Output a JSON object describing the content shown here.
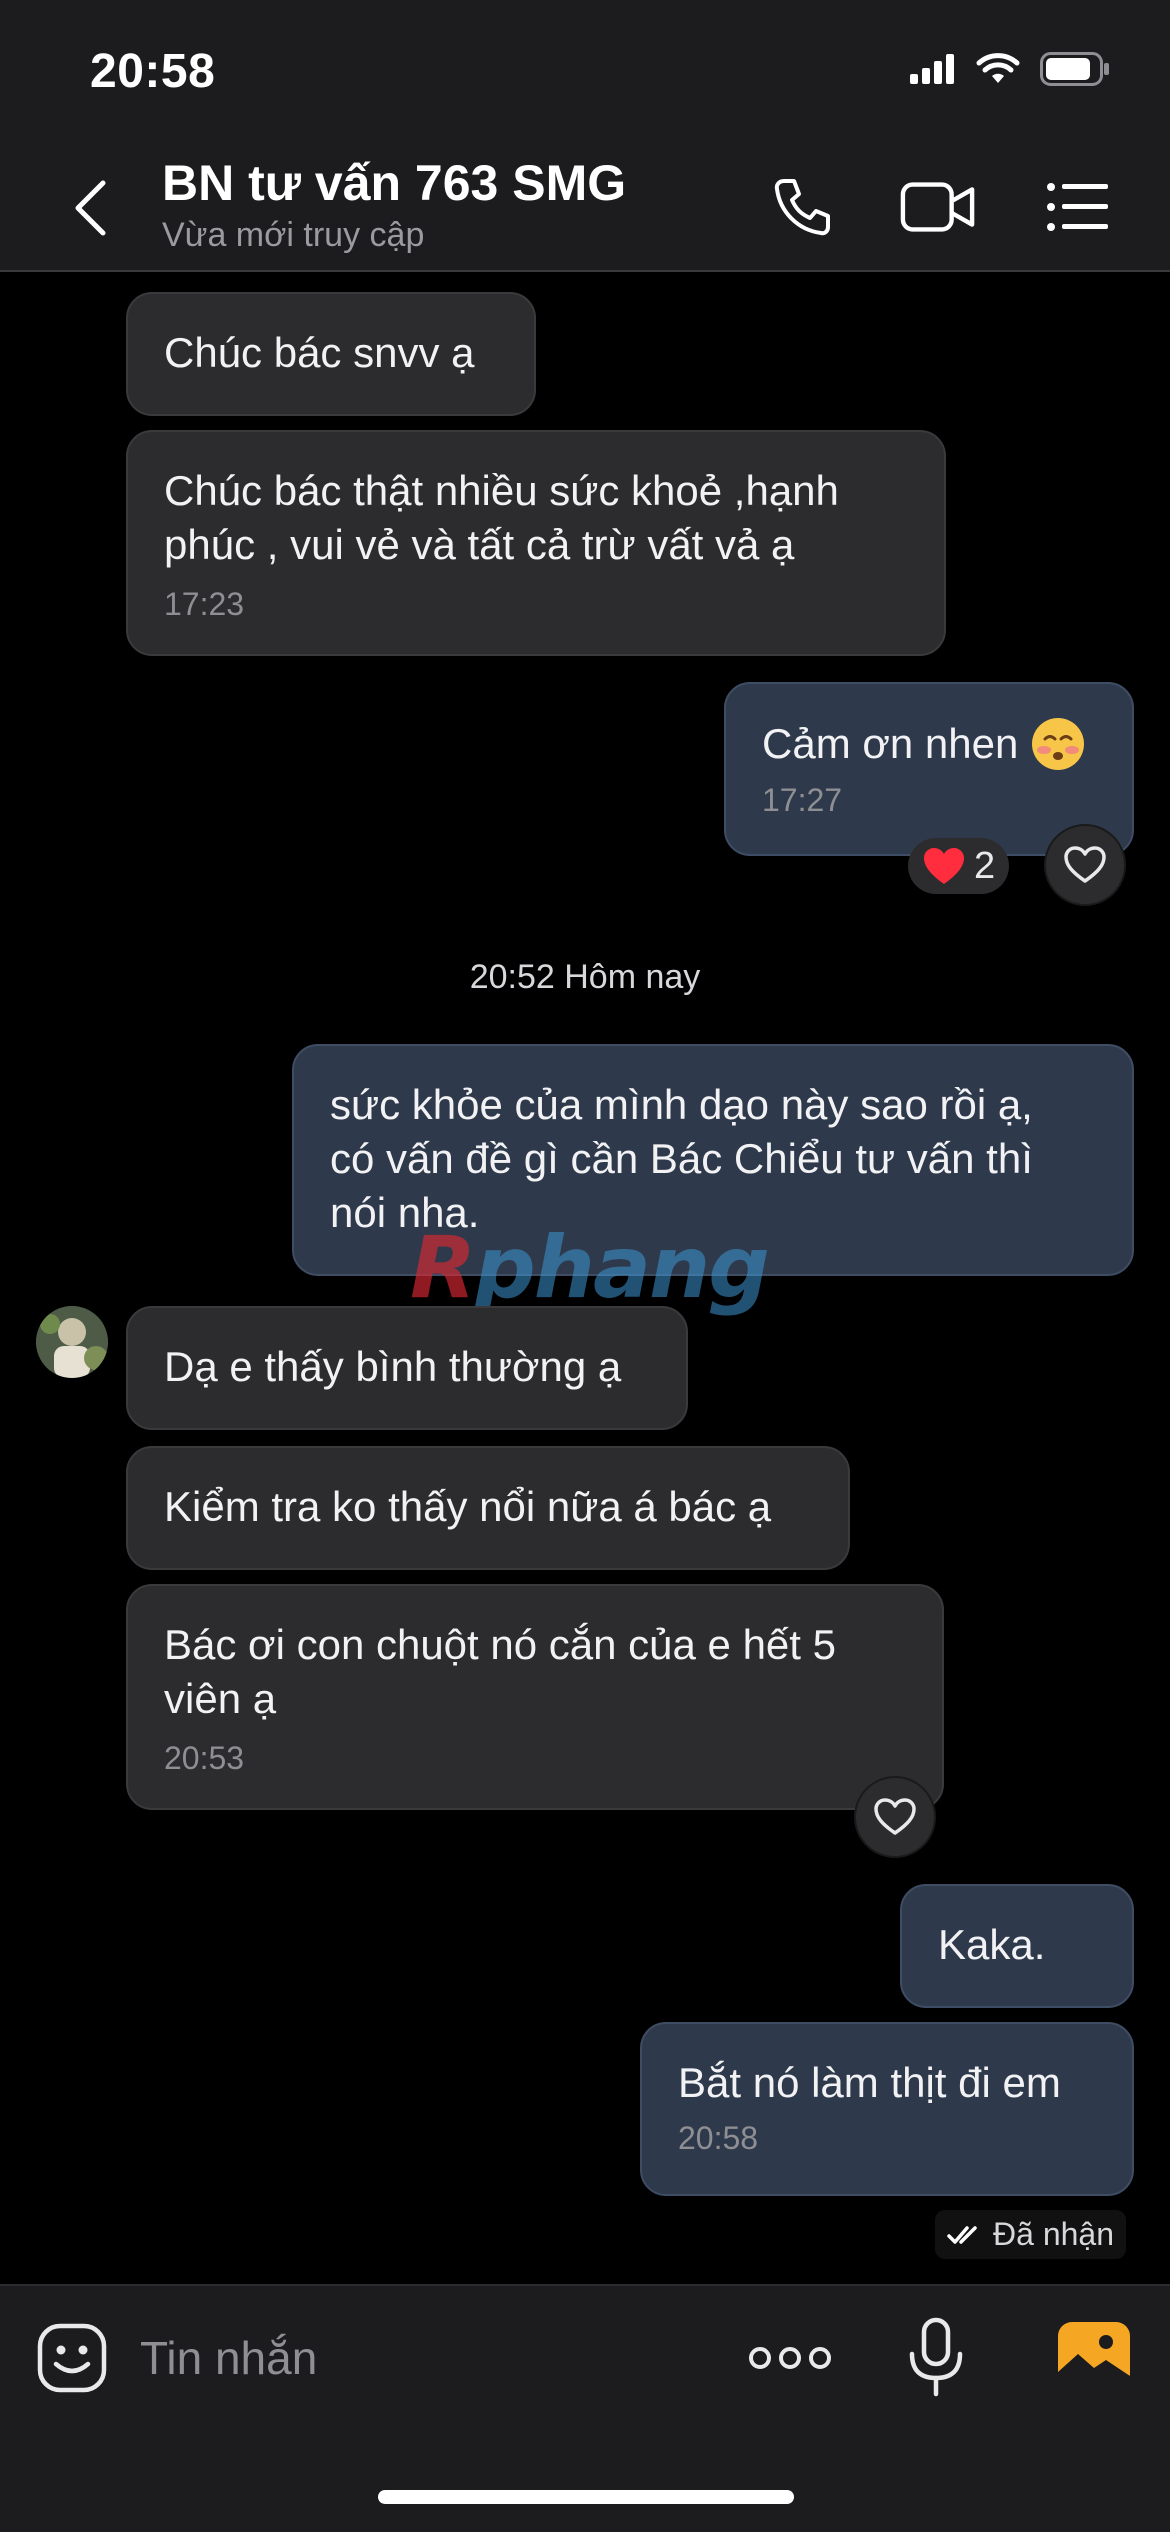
{
  "status_bar": {
    "time": "20:58",
    "icons": [
      "signal-icon",
      "wifi-icon",
      "battery-icon"
    ]
  },
  "header": {
    "title": "BN tư vấn 763 SMG",
    "subtitle": "Vừa mới truy cập",
    "icons": [
      "back-icon",
      "phone-icon",
      "video-icon",
      "list-icon"
    ]
  },
  "messages": [
    {
      "direction": "in",
      "text": "Chúc bác snvv ạ"
    },
    {
      "direction": "in",
      "text": "Chúc bác thật nhiều sức khoẻ ,hạnh\nphúc , vui vẻ và tất cả trừ vất vả ạ",
      "time": "17:23"
    },
    {
      "direction": "out",
      "text": "Cảm ơn nhen",
      "emoji": "blushing-face-emoji",
      "time": "17:27",
      "reactions": {
        "emoji": "red-heart",
        "count": "2"
      }
    },
    {
      "direction": "out",
      "text": "sức khỏe của mình dạo này sao rồi ạ,\ncó vấn đề gì cần Bác Chiểu tư vấn thì\nnói nha."
    },
    {
      "direction": "in",
      "text": "Dạ e thấy bình thường ạ"
    },
    {
      "direction": "in",
      "text": "Kiểm tra ko thấy nổi nữa á bác ạ"
    },
    {
      "direction": "in",
      "text": "Bác ơi con chuột nó cắn của e hết 5\nviên ạ",
      "time": "20:53"
    },
    {
      "direction": "out",
      "text": "Kaka."
    },
    {
      "direction": "out",
      "text": "Bắt nó làm thịt đi em",
      "time": "20:58"
    }
  ],
  "date_separator": "20:52 Hôm nay",
  "watermark": {
    "first": "R",
    "rest": "phang"
  },
  "received_status": "Đã nhận",
  "composer": {
    "placeholder": "Tin nhắn",
    "icons": [
      "sticker-icon",
      "more-dots-icon",
      "microphone-icon",
      "gallery-icon"
    ]
  },
  "colors": {
    "background": "#000000",
    "bar": "#1c1c1e",
    "incoming_bubble": "#2c2c2e",
    "outgoing_bubble": "#2e3a4c",
    "gallery_accent": "#f5a623"
  }
}
